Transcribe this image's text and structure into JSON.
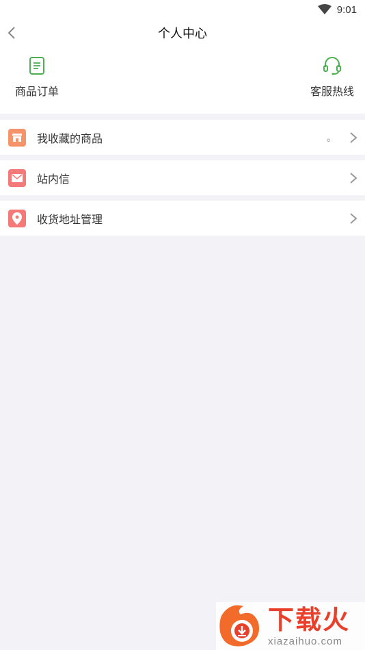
{
  "status_bar": {
    "time": "9:01"
  },
  "header": {
    "title": "个人中心"
  },
  "quick_actions": [
    {
      "label": "商品订单",
      "icon": "document-icon",
      "color": "#4caf50"
    },
    {
      "label": "客服热线",
      "icon": "headset-icon",
      "color": "#4caf50"
    }
  ],
  "menu": [
    {
      "label": "我收藏的商品",
      "icon": "store-icon",
      "color": "#f5946a",
      "extra": "。"
    },
    {
      "label": "站内信",
      "icon": "mail-icon",
      "color": "#f47a7a",
      "extra": ""
    },
    {
      "label": "收货地址管理",
      "icon": "location-pin-icon",
      "color": "#f47a7a",
      "extra": ""
    }
  ],
  "watermark": {
    "cn": "下载火",
    "en": "xiazaihuo.com"
  }
}
